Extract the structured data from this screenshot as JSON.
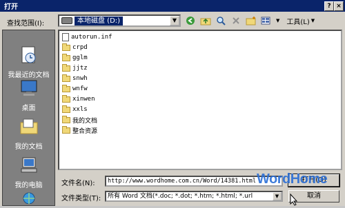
{
  "window": {
    "title": "打开",
    "help": "?",
    "close": "×"
  },
  "lookin": {
    "label": "查找范围(I):",
    "value": "本地磁盘 (D:)"
  },
  "toolbar": {
    "tools_label": "工具(L)"
  },
  "places": [
    {
      "label": "我最近的文档",
      "icon": "recent-docs-icon"
    },
    {
      "label": "桌面",
      "icon": "desktop-icon"
    },
    {
      "label": "我的文档",
      "icon": "my-documents-icon"
    },
    {
      "label": "我的电脑",
      "icon": "my-computer-icon"
    },
    {
      "label": "",
      "icon": "network-places-icon"
    }
  ],
  "files": [
    {
      "name": "autorun.inf",
      "type": "file"
    },
    {
      "name": "crpd",
      "type": "folder"
    },
    {
      "name": "gglm",
      "type": "folder"
    },
    {
      "name": "jjtz",
      "type": "folder"
    },
    {
      "name": "snwh",
      "type": "folder"
    },
    {
      "name": "wnfw",
      "type": "folder"
    },
    {
      "name": "xinwen",
      "type": "folder"
    },
    {
      "name": "xxls",
      "type": "folder"
    },
    {
      "name": "我的文档",
      "type": "folder"
    },
    {
      "name": "整合资源",
      "type": "folder"
    }
  ],
  "filename": {
    "label": "文件名(N):",
    "value": "http://www.wordhome.com.cn/Word/14381.html"
  },
  "filetype": {
    "label": "文件类型(T):",
    "value": "所有 Word 文档(*.doc; *.dot; *.htm; *.html; *.url"
  },
  "buttons": {
    "open": "打开(O)",
    "cancel": "取消"
  },
  "watermark": "WordHome"
}
